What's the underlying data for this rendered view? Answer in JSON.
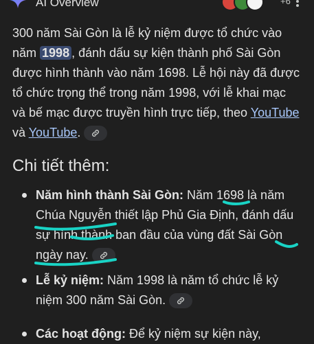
{
  "header": {
    "title": "AI Overview",
    "extra_sources_count": "+6"
  },
  "intro": {
    "t1": "300 năm Sài Gòn là lễ kỷ niệm được tổ chức vào năm ",
    "highlight": "1998",
    "t2": ", đánh dấu sự kiện thành phố Sài Gòn được hình thành vào năm 1698. Lễ hội này đã được tổ chức trọng thể trong năm 1998, với lễ khai mạc và bế mạc được truyền hình trực tiếp, theo ",
    "link1": "YouTube",
    "t3": " và ",
    "link2": "YouTube",
    "t4": "."
  },
  "details": {
    "heading": "Chi tiết thêm:",
    "items": [
      {
        "label": "Năm hình thành Sài Gòn:",
        "text": " Năm 1698 là năm Chúa Nguyễn thiết lập Phủ Gia Định, đánh dấu sự hình thành ban đầu của vùng đất Sài Gòn ngày nay."
      },
      {
        "label": "Lễ kỷ niệm:",
        "text": " Năm 1998 là năm tổ chức lễ kỷ niệm 300 năm Sài Gòn."
      },
      {
        "label": "Các hoạt động:",
        "text": " Để kỷ niệm sự kiện này,"
      }
    ]
  },
  "icons": {
    "overview": "gemini-sparkle-icon",
    "menu": "more-vert-icon",
    "citation": "link-icon"
  },
  "colors": {
    "background": "#1f1f1f",
    "text": "#e3e3e3",
    "link": "#a8c7fa",
    "highlight": "#3a4a70",
    "chip": "#303134",
    "annotation": "#19d3c5"
  }
}
